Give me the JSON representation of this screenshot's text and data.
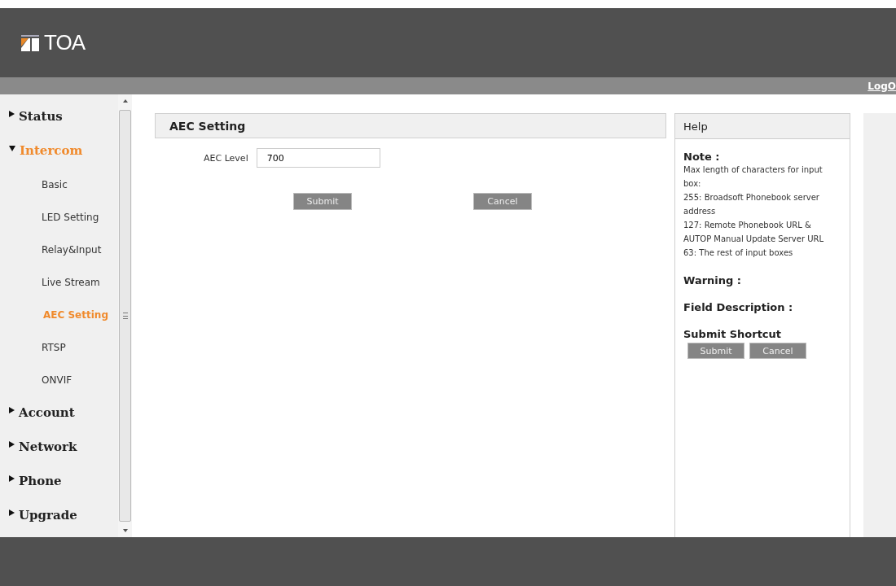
{
  "header": {
    "brand": "TOA"
  },
  "top_bar": {
    "link": "LogO"
  },
  "sidebar": {
    "items": [
      {
        "label": "Status",
        "expanded": false,
        "selected": false
      },
      {
        "label": "Intercom",
        "expanded": true,
        "selected": true,
        "children": [
          {
            "label": "Basic",
            "selected": false
          },
          {
            "label": "LED Setting",
            "selected": false
          },
          {
            "label": "Relay&Input",
            "selected": false
          },
          {
            "label": "Live Stream",
            "selected": false
          },
          {
            "label": "AEC Setting",
            "selected": true
          },
          {
            "label": "RTSP",
            "selected": false
          },
          {
            "label": "ONVIF",
            "selected": false
          }
        ]
      },
      {
        "label": "Account",
        "expanded": false,
        "selected": false
      },
      {
        "label": "Network",
        "expanded": false,
        "selected": false
      },
      {
        "label": "Phone",
        "expanded": false,
        "selected": false
      },
      {
        "label": "Upgrade",
        "expanded": false,
        "selected": false
      }
    ]
  },
  "section": {
    "title": "AEC Setting",
    "fields": [
      {
        "label": "AEC Level",
        "value": "700"
      }
    ],
    "buttons": [
      "Submit",
      "Cancel"
    ]
  },
  "help": {
    "title": "Help",
    "note_title": "Note :",
    "note_lines": [
      "Max length of characters for input box:",
      "255: Broadsoft Phonebook server address",
      "127: Remote Phonebook URL & AUTOP Manual Update Server URL",
      "63: The rest of input boxes"
    ],
    "warning_title": "Warning :",
    "field_description_title": "Field Description :",
    "shortcut_title": "Submit Shortcut",
    "shortcut_buttons": [
      "Submit",
      "Cancel"
    ]
  }
}
